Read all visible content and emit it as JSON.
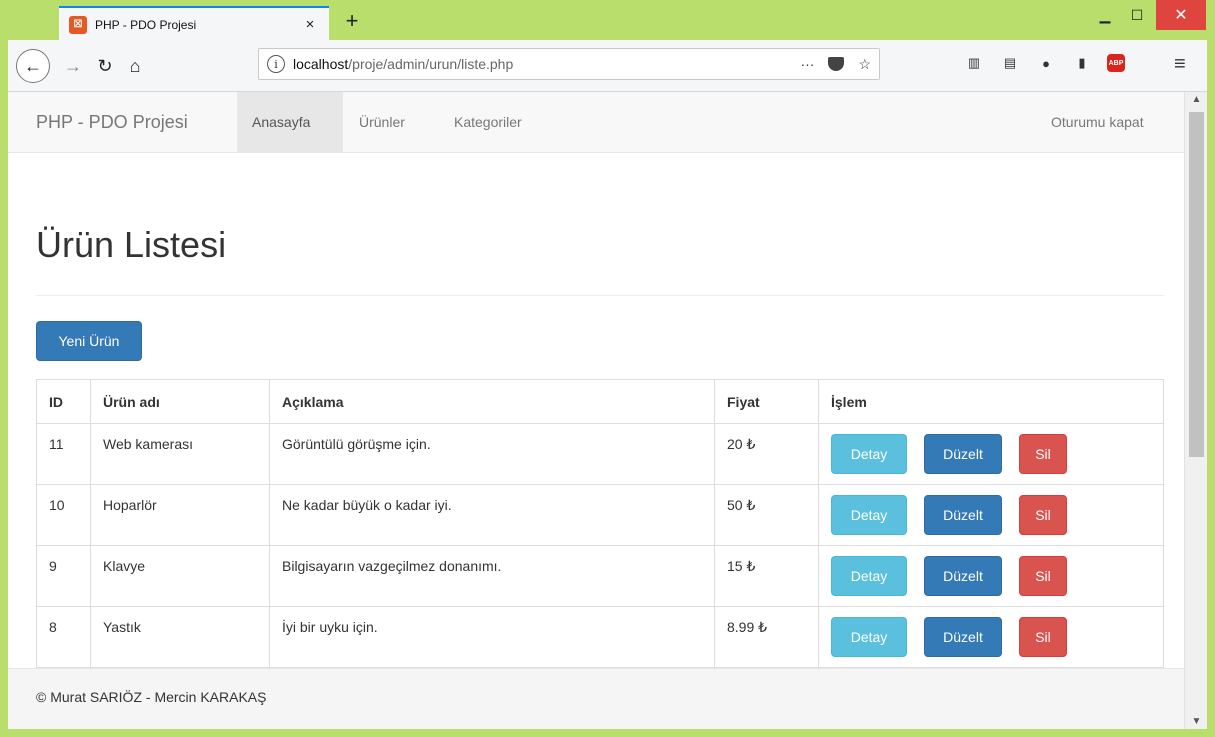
{
  "browser": {
    "tab_title": "PHP - PDO Projesi",
    "tab_close": "×",
    "new_tab": "+",
    "url_host": "localhost",
    "url_path": "/proje/admin/urun/liste.php",
    "url_more": "···"
  },
  "navbar": {
    "brand": "PHP - PDO Projesi",
    "items": [
      {
        "label": "Anasayfa"
      },
      {
        "label": "Ürünler"
      },
      {
        "label": "Kategoriler"
      }
    ],
    "logout": "Oturumu kapat"
  },
  "page": {
    "title": "Ürün Listesi",
    "new_button": "Yeni Ürün"
  },
  "table": {
    "headers": [
      "ID",
      "Ürün adı",
      "Açıklama",
      "Fiyat",
      "İşlem"
    ],
    "rows": [
      {
        "id": "11",
        "name": "Web kamerası",
        "description": "Görüntülü görüşme için.",
        "price": "20 ₺"
      },
      {
        "id": "10",
        "name": "Hoparlör",
        "description": "Ne kadar büyük o kadar iyi.",
        "price": "50 ₺"
      },
      {
        "id": "9",
        "name": "Klavye",
        "description": "Bilgisayarın vazgeçilmez donanımı.",
        "price": "15 ₺"
      },
      {
        "id": "8",
        "name": "Yastık",
        "description": "İyi bir uyku için.",
        "price": "8.99 ₺"
      }
    ],
    "actions": {
      "detail": "Detay",
      "edit": "Düzelt",
      "delete": "Sil"
    }
  },
  "footer": {
    "text": "© Murat SARIÖZ - Mercin KARAKAŞ"
  },
  "colors": {
    "primary": "#337ab7",
    "info": "#5bc0de",
    "danger": "#d9534f",
    "window_frame": "#b9de6b"
  }
}
